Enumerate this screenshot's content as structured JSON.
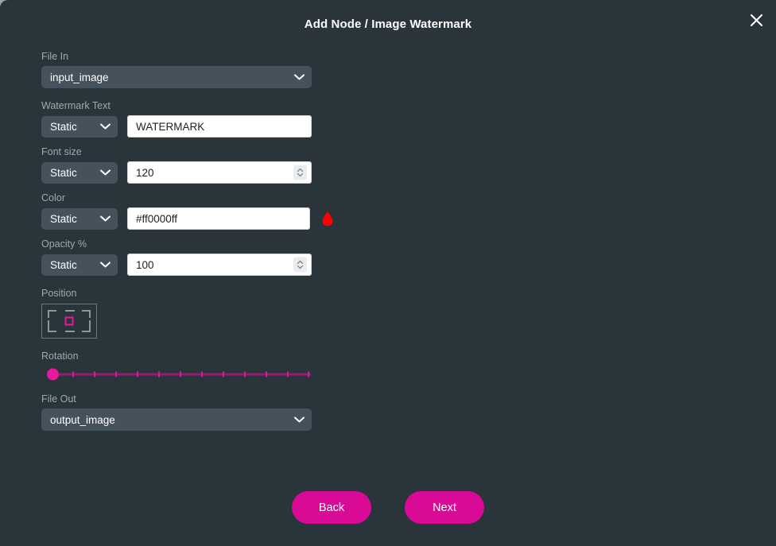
{
  "dialog": {
    "title": "Add Node / Image Watermark",
    "close_icon": "close-icon"
  },
  "fields": {
    "file_in": {
      "label": "File In",
      "value": "input_image"
    },
    "watermark_text": {
      "label": "Watermark Text",
      "mode": "Static",
      "value": "WATERMARK"
    },
    "font_size": {
      "label": "Font size",
      "mode": "Static",
      "value": "120"
    },
    "color": {
      "label": "Color",
      "mode": "Static",
      "value": "#ff0000ff",
      "swatch": "#ff0000"
    },
    "opacity": {
      "label": "Opacity %",
      "mode": "Static",
      "value": "100"
    },
    "position": {
      "label": "Position",
      "selected": "center"
    },
    "rotation": {
      "label": "Rotation",
      "value": 0,
      "min": 0,
      "max": 360,
      "ticks": 12
    },
    "file_out": {
      "label": "File Out",
      "value": "output_image"
    }
  },
  "footer": {
    "back_label": "Back",
    "next_label": "Next"
  },
  "theme": {
    "background": "#29343b",
    "accent": "#d80a96",
    "select_bg": "#45525b",
    "label_color": "#9fa9ae"
  }
}
